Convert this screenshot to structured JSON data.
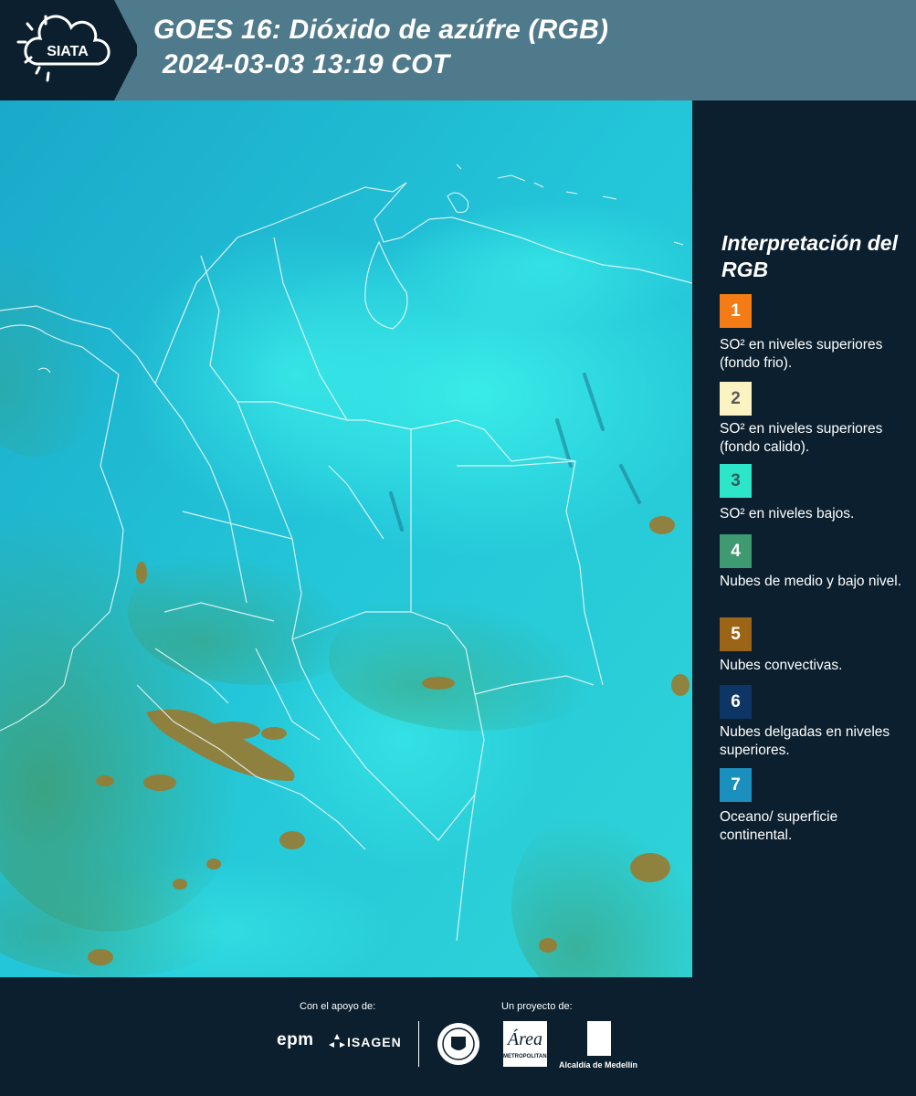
{
  "header": {
    "logo_text": "SIATA",
    "title_line1": "GOES 16: Dióxido de azúfre (RGB)",
    "title_line2": "2024-03-03 13:19 COT"
  },
  "legend": {
    "title": "Interpretación del RGB",
    "items": [
      {
        "number": "1",
        "color": "#f47b16",
        "text_color": "#ffffff",
        "label": "SO² en niveles superiores (fondo frio)."
      },
      {
        "number": "2",
        "color": "#fbf4c2",
        "text_color": "#5a5a5a",
        "label": "SO² en niveles superiores (fondo calido)."
      },
      {
        "number": "3",
        "color": "#2de6c9",
        "text_color": "#2b5f5a",
        "label": "SO² en niveles bajos."
      },
      {
        "number": "4",
        "color": "#3f9a72",
        "text_color": "#ffffff",
        "label": "Nubes de medio y bajo nivel."
      },
      {
        "number": "5",
        "color": "#9b6417",
        "text_color": "#ffffff",
        "label": "Nubes convectivas."
      },
      {
        "number": "6",
        "color": "#0d3566",
        "text_color": "#ffffff",
        "label": "Nubes delgadas en niveles superiores."
      },
      {
        "number": "7",
        "color": "#1b8fbd",
        "text_color": "#ffffff",
        "label": "Oceano/ superficie continental."
      }
    ]
  },
  "footer": {
    "support_label": "Con el apoyo de:",
    "project_label": "Un proyecto de:",
    "sponsor_1": "epm",
    "sponsor_2": "ISAGEN",
    "partner_amva": "METROPOLITANA",
    "partner_alcaldia": "Alcaldía de Medellín"
  },
  "map": {
    "theme": "GOES-16 SO2 RGB composite over Colombia",
    "colors": {
      "ocean_cyan": "#1fb8cf",
      "land_green": "#3c9c82",
      "convective_brown": "#9a7a30",
      "high_cloud": "#2be3e0"
    }
  }
}
